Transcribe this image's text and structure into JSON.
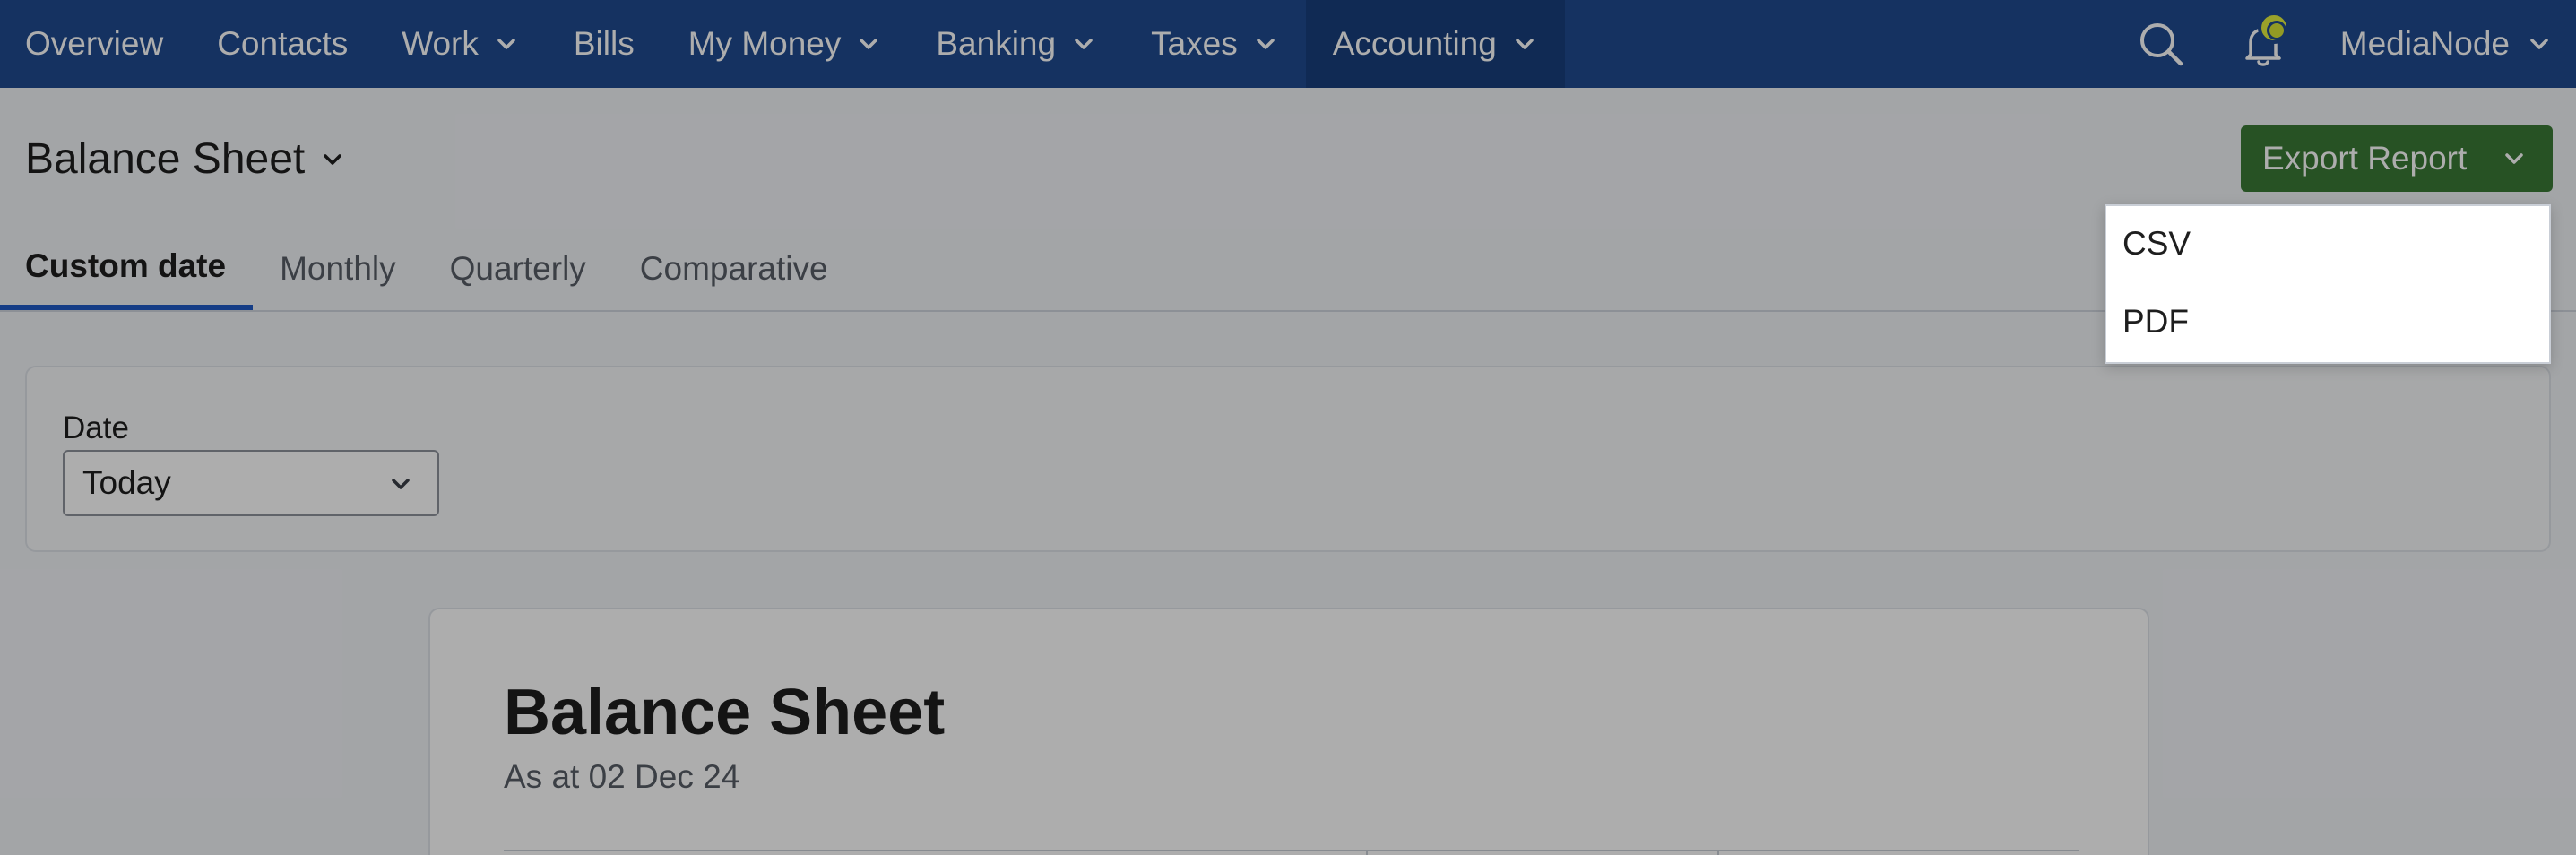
{
  "navbar": {
    "items": [
      {
        "label": "Overview",
        "has_dropdown": false,
        "active": false
      },
      {
        "label": "Contacts",
        "has_dropdown": false,
        "active": false
      },
      {
        "label": "Work",
        "has_dropdown": true,
        "active": false
      },
      {
        "label": "Bills",
        "has_dropdown": false,
        "active": false
      },
      {
        "label": "My Money",
        "has_dropdown": true,
        "active": false
      },
      {
        "label": "Banking",
        "has_dropdown": true,
        "active": false
      },
      {
        "label": "Taxes",
        "has_dropdown": true,
        "active": false
      },
      {
        "label": "Accounting",
        "has_dropdown": true,
        "active": true
      }
    ],
    "search_icon": "search-icon",
    "notifications_icon": "bell-icon",
    "account_label": "MediaNode"
  },
  "page": {
    "title": "Balance Sheet",
    "export_button_label": "Export Report"
  },
  "tabs": [
    {
      "label": "Custom date",
      "active": true
    },
    {
      "label": "Monthly",
      "active": false
    },
    {
      "label": "Quarterly",
      "active": false
    },
    {
      "label": "Comparative",
      "active": false
    }
  ],
  "filters": {
    "date_label": "Date",
    "date_value": "Today"
  },
  "report": {
    "title": "Balance Sheet",
    "subtitle": "As at 02 Dec 24"
  },
  "export_menu": {
    "options": [
      "CSV",
      "PDF"
    ]
  },
  "colors": {
    "navbar_bg": "#1f4b8f",
    "navbar_active_bg": "#183f7d",
    "export_button_bg": "#3a7a35",
    "active_tab_underline": "#1f5bc6",
    "notification_dot": "#e4ef3e"
  }
}
